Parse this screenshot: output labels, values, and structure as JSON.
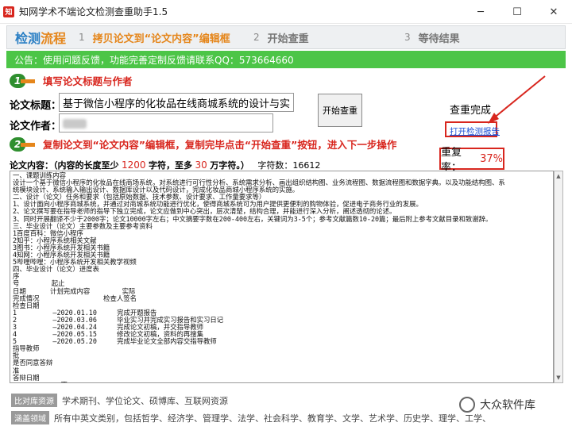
{
  "window": {
    "title": "知网学术不端论文检测查重助手1.5",
    "controls": [
      "─",
      "☐",
      "✕"
    ]
  },
  "steps": {
    "header_part1": "检测",
    "header_part2": "流程",
    "items": [
      {
        "num": "1",
        "label": "拷贝论文到“论文内容”编辑框"
      },
      {
        "num": "2",
        "label": "开始查重"
      },
      {
        "num": "3",
        "label": "等待结果"
      }
    ]
  },
  "notice": "公告：使用问题反馈，功能完善定制反馈请联系QQ：573664660",
  "section1": {
    "badge": "1",
    "text": "填写论文标题与作者"
  },
  "title_field": {
    "label": "论文标题：",
    "value": "基于微信小程序的化妆品在线商城系统的设计与实现"
  },
  "author_field": {
    "label": "论文作者："
  },
  "start_button": "开始查重",
  "status": {
    "done": "查重完成",
    "link": "打开检测报告",
    "rate_label": "重复率：",
    "rate_value": "37%"
  },
  "section2": {
    "badge": "2",
    "text": "复制论文到“论文内容”编辑框，复制完毕点击“开始查重”按钮，进入下一步操作"
  },
  "content_info": {
    "prefix": "论文内容：（内容的长度至少",
    "min": "1200",
    "mid": "字符，至多",
    "max": "30",
    "suffix": "万字符。）",
    "count_label": "字符数：",
    "count": "16612"
  },
  "content_text": "一、课题训练内容\n设计一个基于微信小程序的化妆品在线商场系统，对系统进行可行性分析、系统需求分析、画出组织结构图、业务流程图、数据流程图和数据字典。以及功能结构图、系\n统模块设计、系统输入输出设计、数据库设计以及代码设计，完成化妆品商城小程序系统的实施。\n二、设计（论文）任务和要求（包括原始数据、技术参数、设计要求、工作量要求等）\n1、设计面向小程序商城系统，并通过对商城系统功能进行优化，使得商城系统可为用户提供更便利的购物体验，促进电子商务行业的发展。\n2、论文撰写要在指导老师的指导下独立完成，论文应做到中心突出，层次清楚，结构合理，并能进行深入分析，阐述透彻的论述。\n3、同时开展翻译不少于2000字；论文10000字左右；中文摘要字数在200-400左右，关键词为3-5个；参考文献篇数10-20篇；最后附上参考文献目录和致谢辞。\n三、毕业设计（论文）主要参数及主要参考资料\n1百度百科：微信小程序\n2知乎：小程序系统相关文献\n3图书：小程序系统开发相关书籍\n4知网：小程序系统开发相关书籍\n5哔哩哔哩：小程序系统开发相关教学视频\n四、毕业设计（论文）进度表\n序\n号        起止\n日期      计划完成内容        实际\n完成情况                检查人签名\n检查日期\n1         —2020.01.10     完成开题报告\n2         —2020.03.06     毕业实习并完成实习报告和实习日记\n3         —2020.04.24     完成论文初稿，并交指导教师\n4         —2020.05.15     修改论文初稿，资料的再搜集\n5         —2020.05.20     完成毕业论文全部内容交指导教师\n指导教师\n批\n是否同意答辩\n准\n答辩日期\n            否",
  "footer": {
    "row1_tag": "比对库资源",
    "row1_text": "学术期刊、学位论文、硕博库、互联网资源",
    "row2_tag": "涵盖领域",
    "row2_text": "所有中英文类别，包括哲学、经济学、管理学、法学、社会科学、教育学、文学、艺术学、历史学、理学、工学、农学、医学、军事学等",
    "watermark": "大众软件库"
  }
}
